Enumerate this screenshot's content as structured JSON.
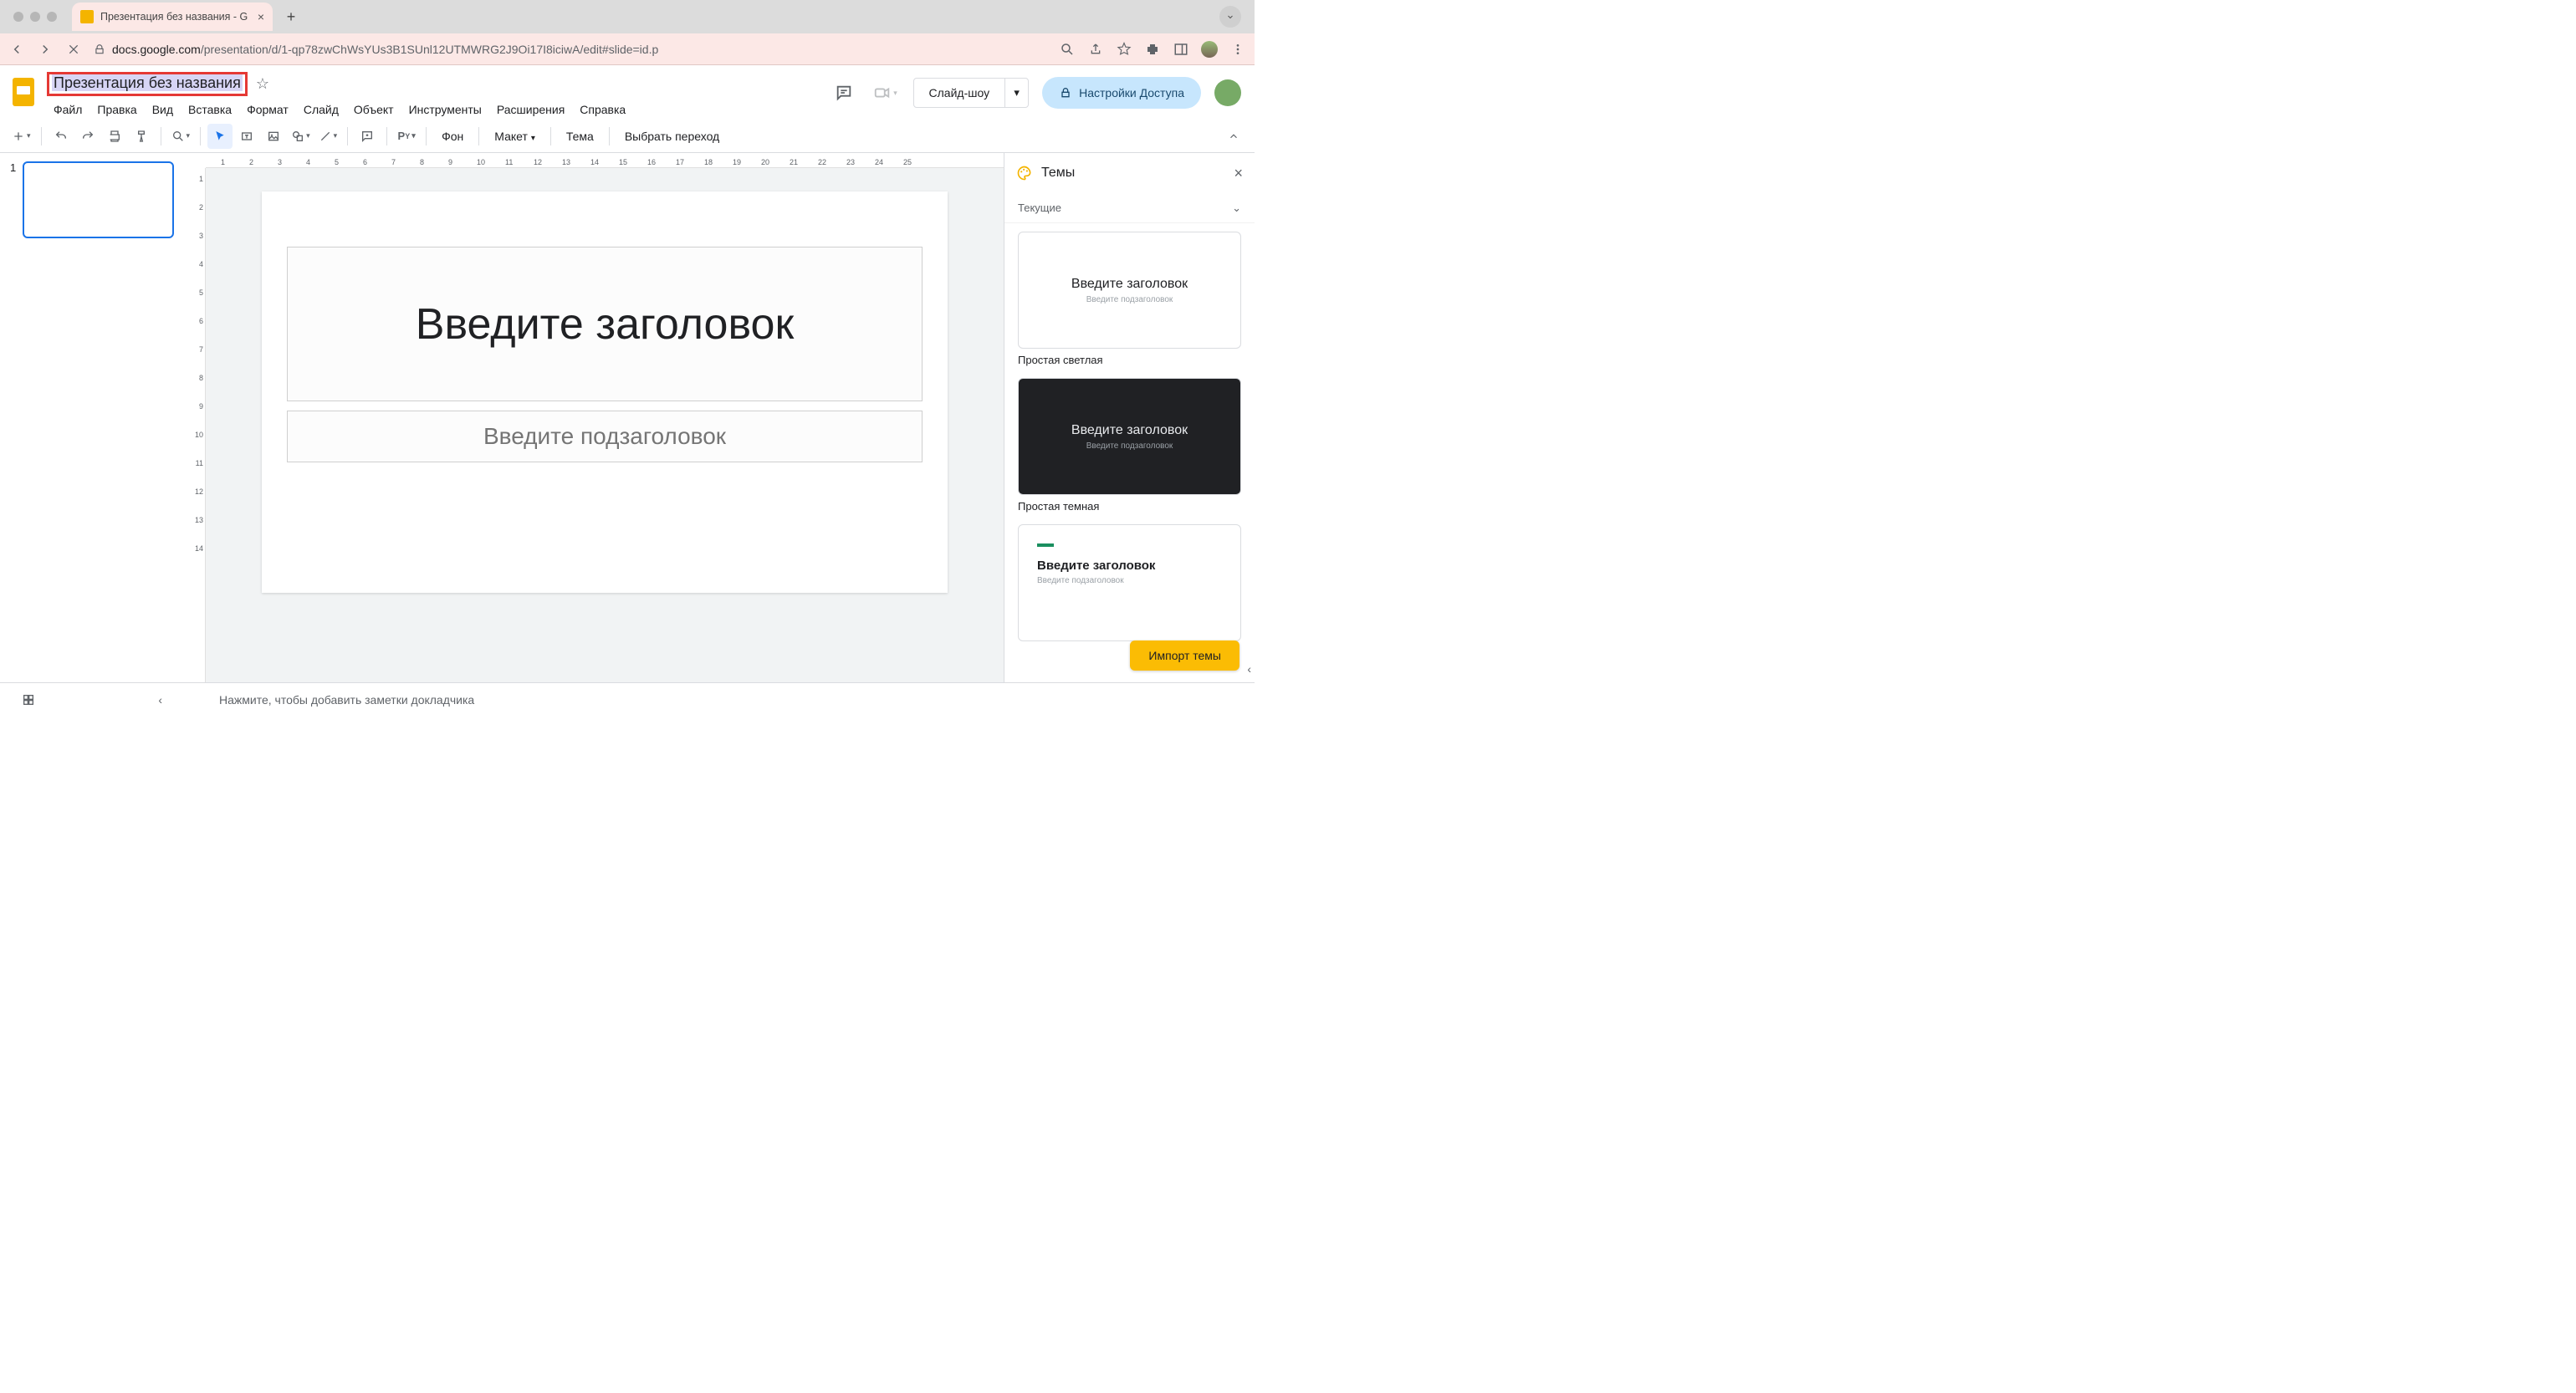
{
  "browser": {
    "tab_title": "Презентация без названия - G",
    "url_host": "docs.google.com",
    "url_path": "/presentation/d/1-qp78zwChWsYUs3B1SUnl12UTMWRG2J9Oi17I8iciwA/edit#slide=id.p"
  },
  "header": {
    "doc_title": "Презентация без названия",
    "menu": [
      "Файл",
      "Правка",
      "Вид",
      "Вставка",
      "Формат",
      "Слайд",
      "Объект",
      "Инструменты",
      "Расширения",
      "Справка"
    ],
    "slideshow_label": "Слайд-шоу",
    "share_label": "Настройки Доступа"
  },
  "toolbar": {
    "background": "Фон",
    "layout": "Макет",
    "theme": "Тема",
    "transition": "Выбрать переход"
  },
  "canvas": {
    "slide_number": "1",
    "title_placeholder": "Введите заголовок",
    "subtitle_placeholder": "Введите подзаголовок"
  },
  "notes": {
    "placeholder": "Нажмите, чтобы добавить заметки докладчика"
  },
  "themes_panel": {
    "title": "Темы",
    "current_label": "Текущие",
    "cards": [
      {
        "title": "Введите заголовок",
        "sub": "Введите подзаголовок",
        "label": "Простая светлая",
        "variant": "light"
      },
      {
        "title": "Введите заголовок",
        "sub": "Введите подзаголовок",
        "label": "Простая темная",
        "variant": "dark"
      },
      {
        "title": "Введите заголовок",
        "sub": "Введите подзаголовок",
        "label": "",
        "variant": "stripe"
      }
    ],
    "import_label": "Импорт темы"
  },
  "ruler_h": [
    "1",
    "2",
    "3",
    "4",
    "5",
    "6",
    "7",
    "8",
    "9",
    "10",
    "11",
    "12",
    "13",
    "14",
    "15",
    "16",
    "17",
    "18",
    "19",
    "20",
    "21",
    "22",
    "23",
    "24",
    "25"
  ],
  "ruler_v": [
    "1",
    "2",
    "3",
    "4",
    "5",
    "6",
    "7",
    "8",
    "9",
    "10",
    "11",
    "12",
    "13",
    "14"
  ]
}
